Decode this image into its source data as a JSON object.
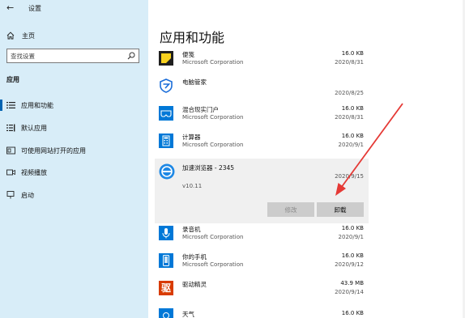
{
  "window": {
    "title": "设置",
    "back_icon": "back-arrow-icon"
  },
  "sidebar": {
    "home_label": "主页",
    "search_placeholder": "查找设置",
    "section_title": "应用",
    "items": [
      {
        "label": "应用和功能",
        "icon": "list-icon",
        "selected": true
      },
      {
        "label": "默认应用",
        "icon": "default-apps-icon",
        "selected": false
      },
      {
        "label": "可使用网站打开的应用",
        "icon": "website-apps-icon",
        "selected": false
      },
      {
        "label": "视频播放",
        "icon": "video-icon",
        "selected": false
      },
      {
        "label": "启动",
        "icon": "startup-icon",
        "selected": false
      }
    ]
  },
  "main": {
    "title": "应用和功能",
    "apps": [
      {
        "name": "便笺",
        "publisher": "Microsoft Corporation",
        "size": "16.0 KB",
        "date": "2020/8/31",
        "icon": "sticky-notes-icon",
        "icon_color": "#f7d11e"
      },
      {
        "name": "电脑管家",
        "publisher": "",
        "size": "",
        "date": "2020/8/25",
        "icon": "pc-manager-icon",
        "icon_color": "#1a6dd9"
      },
      {
        "name": "混合现实门户",
        "publisher": "Microsoft Corporation",
        "size": "16.0 KB",
        "date": "2020/8/31",
        "icon": "mixed-reality-icon",
        "icon_color": "#0078d7"
      },
      {
        "name": "计算器",
        "publisher": "Microsoft Corporation",
        "size": "16.0 KB",
        "date": "2020/9/1",
        "icon": "calculator-icon",
        "icon_color": "#0078d7"
      },
      {
        "name": "加速浏览器 - 2345",
        "publisher": "",
        "size": "",
        "date": "2020/9/15",
        "version": "v10.11",
        "icon": "browser-2345-icon",
        "icon_color": "#1e88e5",
        "selected": true,
        "modify_label": "修改",
        "uninstall_label": "卸载"
      },
      {
        "name": "录音机",
        "publisher": "Microsoft Corporation",
        "size": "16.0 KB",
        "date": "2020/9/1",
        "icon": "voice-recorder-icon",
        "icon_color": "#0078d7"
      },
      {
        "name": "你的手机",
        "publisher": "Microsoft Corporation",
        "size": "16.0 KB",
        "date": "2020/9/12",
        "icon": "your-phone-icon",
        "icon_color": "#0078d7"
      },
      {
        "name": "驱动精灵",
        "publisher": "",
        "size": "43.9 MB",
        "date": "2020/9/14",
        "icon": "driver-genius-icon",
        "icon_color": "#d83b01",
        "icon_text": "驱"
      },
      {
        "name": "天气",
        "publisher": "",
        "size": "16.0 KB",
        "date": "",
        "icon": "weather-icon",
        "icon_color": "#0078d7"
      }
    ]
  },
  "annotation": {
    "type": "arrow",
    "color": "#e53935",
    "points_to": "卸载"
  }
}
